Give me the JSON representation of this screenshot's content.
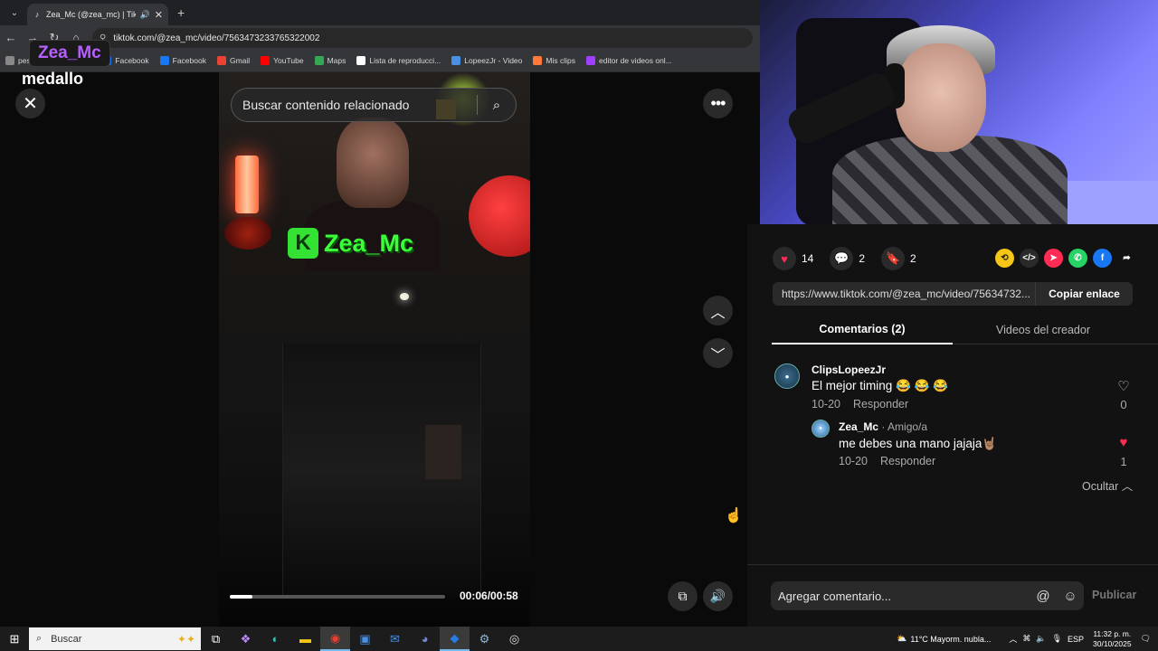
{
  "browser": {
    "tab_title": "Zea_Mc (@zea_mc) | TikTok",
    "url": "tiktok.com/@zea_mc/video/7563473233765322002",
    "bookmarks": [
      {
        "label": "pestaña",
        "icon": "page-icon",
        "color": "#888888"
      },
      {
        "label": "Twitter",
        "icon": "x-icon",
        "color": "#ffffff"
      },
      {
        "label": "Facebook",
        "icon": "facebook-icon",
        "color": "#1877f2"
      },
      {
        "label": "Facebook",
        "icon": "facebook-icon",
        "color": "#1877f2"
      },
      {
        "label": "Gmail",
        "icon": "gmail-icon",
        "color": "#ea4335"
      },
      {
        "label": "YouTube",
        "icon": "youtube-icon",
        "color": "#ff0000"
      },
      {
        "label": "Maps",
        "icon": "maps-icon",
        "color": "#34a853"
      },
      {
        "label": "Lista de reproducci...",
        "icon": "tiktok-icon",
        "color": "#ffffff"
      },
      {
        "label": "LopeezJr - Video",
        "icon": "video-icon",
        "color": "#4a90e2"
      },
      {
        "label": "Mis clips",
        "icon": "clips-icon",
        "color": "#ff7a3a"
      },
      {
        "label": "editor de videos onl...",
        "icon": "editor-icon",
        "color": "#a040ff"
      }
    ]
  },
  "overlay": {
    "streamer_name": "Zea_Mc",
    "caption": "medallo"
  },
  "viewer": {
    "search_placeholder": "Buscar contenido relacionado",
    "watermark_letter": "K",
    "watermark_text": "Zea_Mc",
    "time": "00:06/00:58",
    "progress": 0.103
  },
  "actions": {
    "likes": "14",
    "comments": "2",
    "saves": "2",
    "share_link": "https://www.tiktok.com/@zea_mc/video/75634732...",
    "copy_label": "Copiar enlace"
  },
  "tabs": {
    "comments": "Comentarios (2)",
    "creator_videos": "Videos del creador"
  },
  "comments": [
    {
      "author": "ClipsLopeezJr",
      "tag": "",
      "text": "El mejor timing 😂 😂 😂",
      "date": "10-20",
      "reply": "Responder",
      "likes": "0",
      "liked": false
    },
    {
      "author": "Zea_Mc",
      "tag": " · Amigo/a",
      "text": "me debes una mano jajaja🤘🏽",
      "date": "10-20",
      "reply": "Responder",
      "likes": "1",
      "liked": true
    }
  ],
  "hide_label": "Ocultar",
  "composer": {
    "placeholder": "Agregar comentario...",
    "publish": "Publicar"
  },
  "taskbar": {
    "search": "Buscar",
    "weather": "11°C  Mayorm. nubla...",
    "lang": "ESP",
    "time": "11:32 p. m.",
    "date": "30/10/2025"
  },
  "colors": {
    "accent": "#fe2c55",
    "streamer": "#b660ff",
    "watermark": "#3aff3a"
  }
}
